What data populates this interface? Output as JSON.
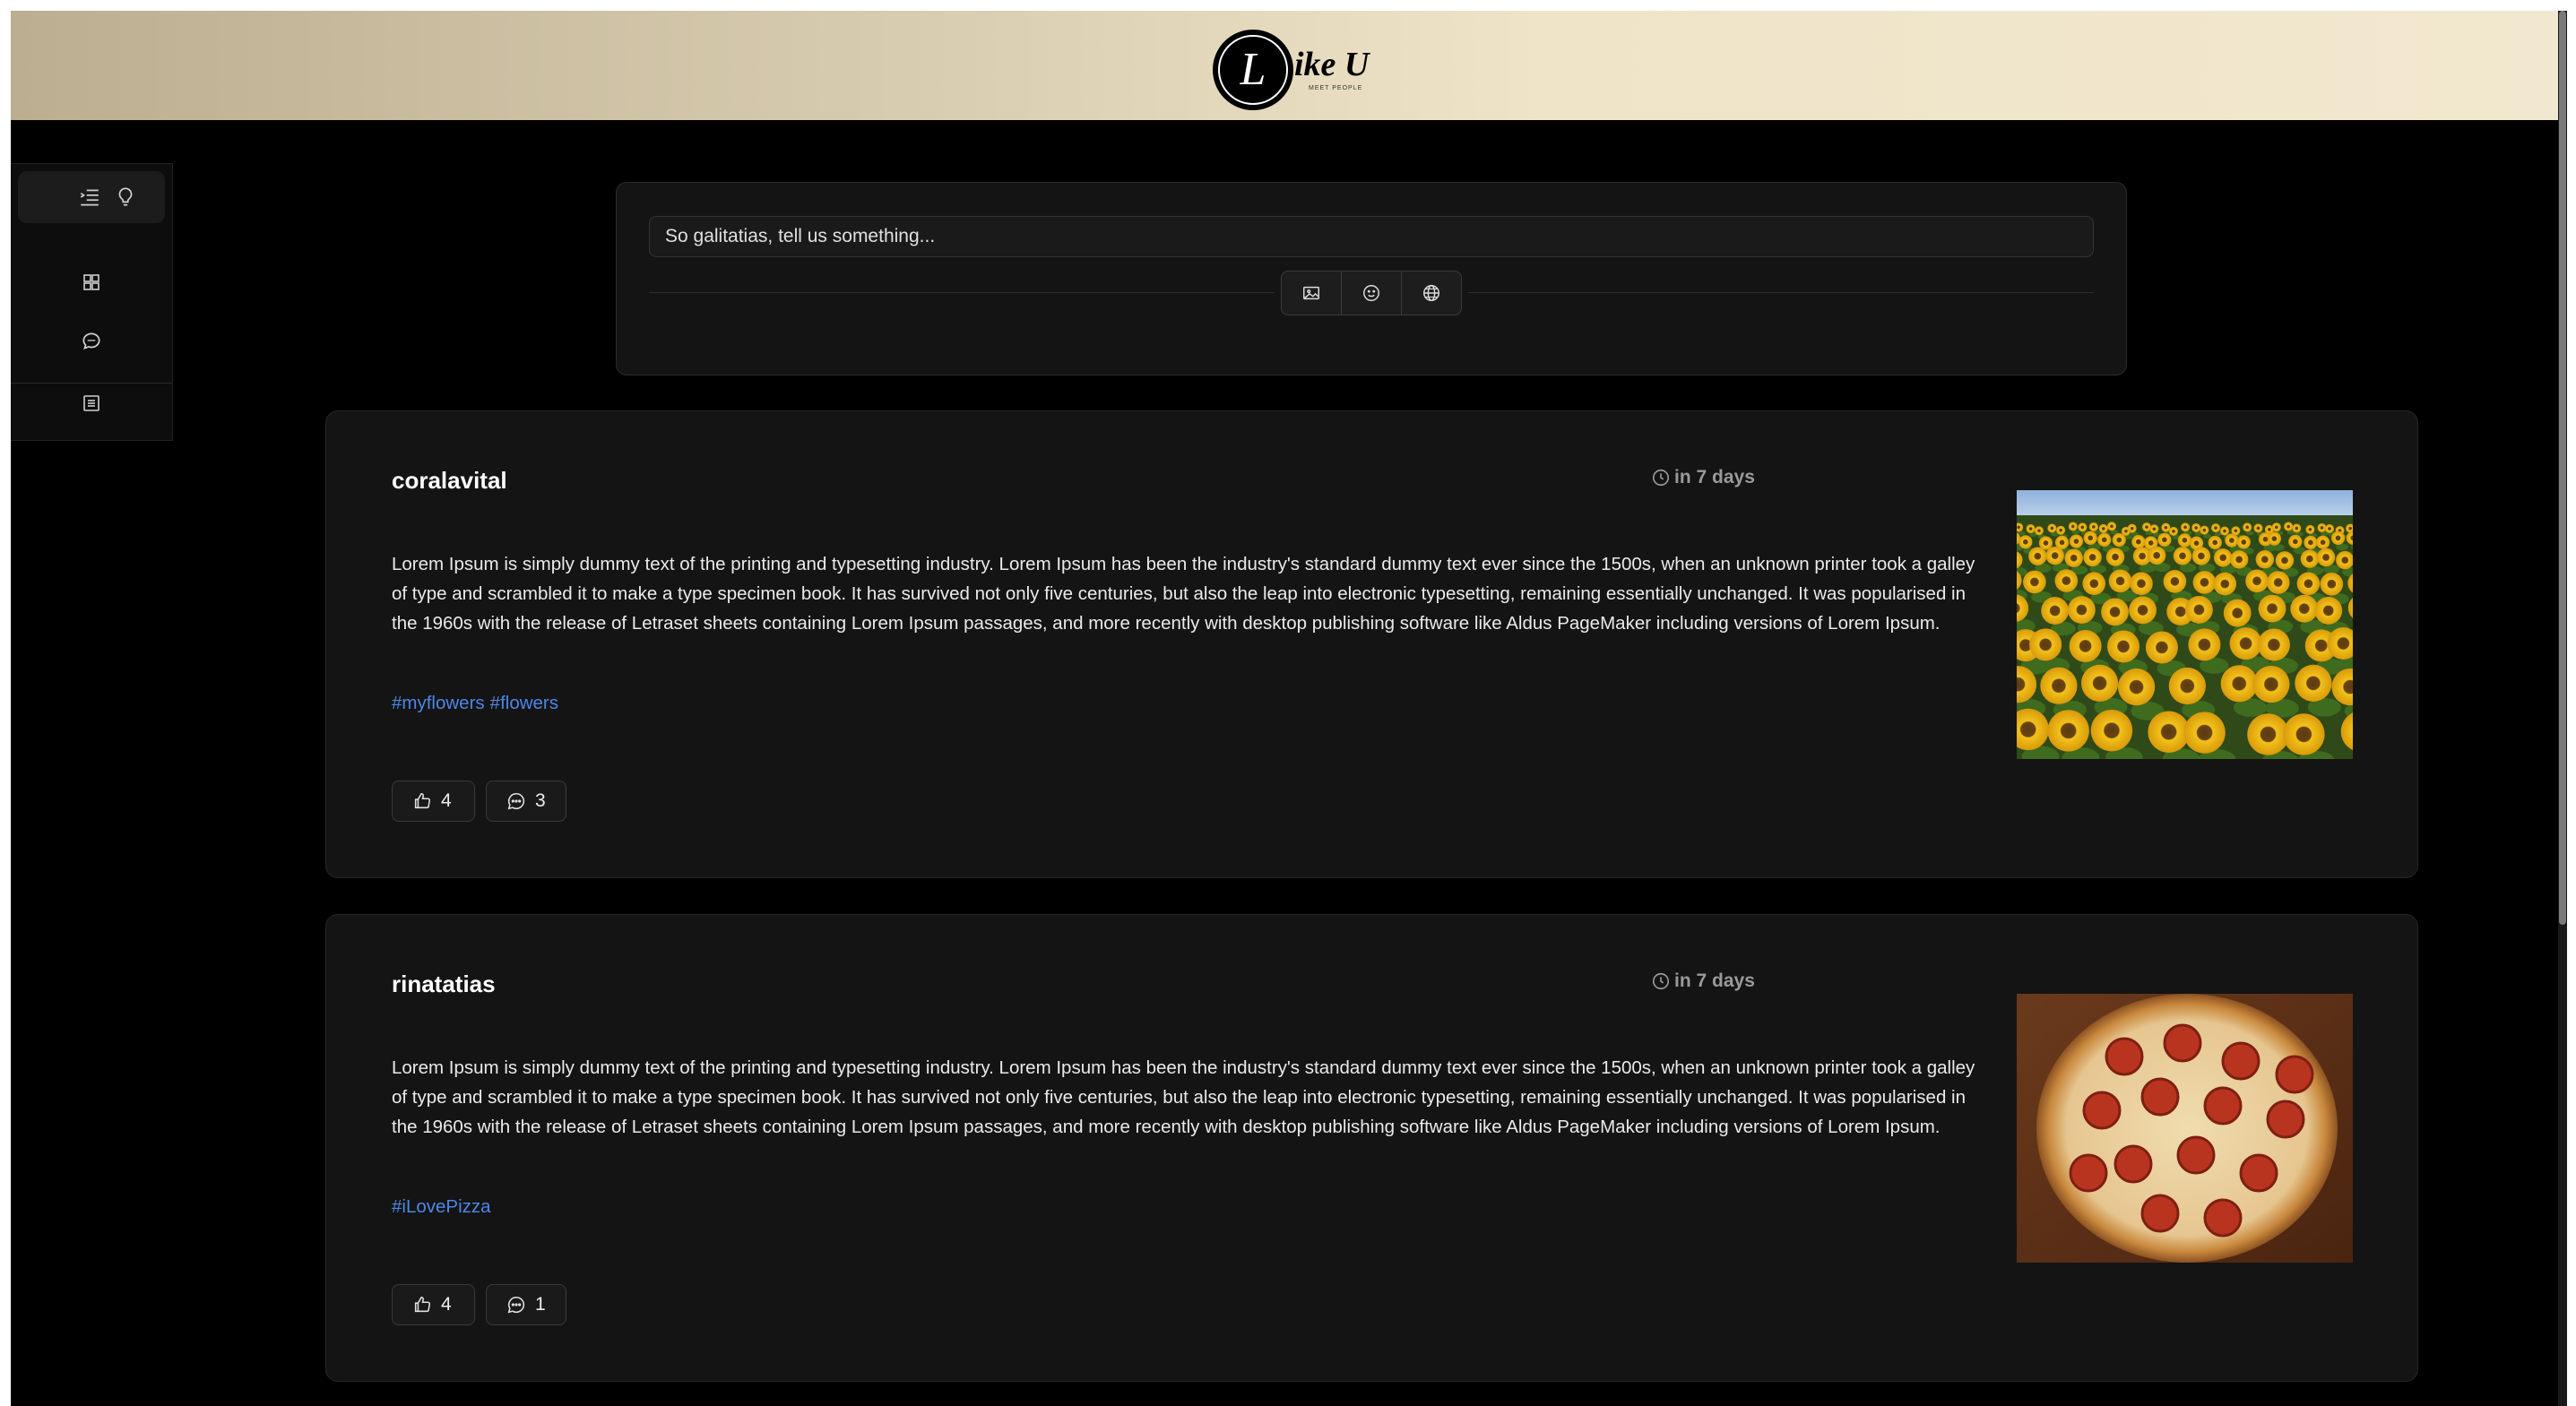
{
  "header": {
    "logo_letter": "L",
    "logo_text": "ike U",
    "logo_tagline": "MEET PEOPLE"
  },
  "sidebar": {
    "items": [
      {
        "icon": "list-indent-icon"
      },
      {
        "icon": "lightbulb-icon"
      },
      {
        "icon": "grid-icon"
      },
      {
        "icon": "chat-icon"
      },
      {
        "icon": "document-list-icon"
      }
    ]
  },
  "composer": {
    "placeholder": "So galitatias, tell us something...",
    "tools": [
      {
        "icon": "image-icon"
      },
      {
        "icon": "emoji-icon"
      },
      {
        "icon": "globe-icon"
      }
    ]
  },
  "posts": [
    {
      "username": "coralavital",
      "time": "in 7 days",
      "text": "Lorem Ipsum is simply dummy text of the printing and typesetting industry. Lorem Ipsum has been the industry's standard dummy text ever since the 1500s, when an unknown printer took a galley of type and scrambled it to make a type specimen book. It has survived not only five centuries, but also the leap into electronic typesetting, remaining essentially unchanged. It was popularised in the 1960s with the release of Letraset sheets containing Lorem Ipsum passages, and more recently with desktop publishing software like Aldus PageMaker including versions of Lorem Ipsum.",
      "tags": [
        "#myflowers",
        "#flowers"
      ],
      "likes": "4",
      "comments": "3",
      "image": "sunflower-field"
    },
    {
      "username": "rinatatias",
      "time": "in 7 days",
      "text": "Lorem Ipsum is simply dummy text of the printing and typesetting industry. Lorem Ipsum has been the industry's standard dummy text ever since the 1500s, when an unknown printer took a galley of type and scrambled it to make a type specimen book. It has survived not only five centuries, but also the leap into electronic typesetting, remaining essentially unchanged. It was popularised in the 1960s with the release of Letraset sheets containing Lorem Ipsum passages, and more recently with desktop publishing software like Aldus PageMaker including versions of Lorem Ipsum.",
      "tags": [
        "#iLovePizza"
      ],
      "likes": "4",
      "comments": "1",
      "image": "pepperoni-pizza"
    }
  ],
  "colors": {
    "background": "#000000",
    "card": "#141414",
    "hashtag": "#4d86e6",
    "header_gradient_start": "#bcae90",
    "header_gradient_end": "#f2e8cf"
  }
}
